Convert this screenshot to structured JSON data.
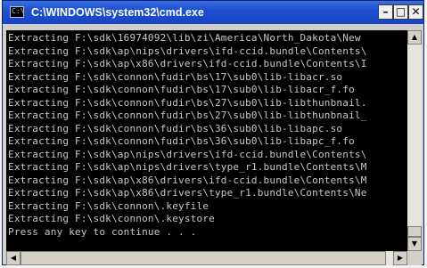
{
  "window": {
    "title": "C:\\WINDOWS\\system32\\cmd.exe",
    "icon_label": "C:\\",
    "buttons": {
      "minimize": "–",
      "maximize": "□",
      "close": "✕"
    }
  },
  "console": {
    "lines": [
      "Extracting F:\\sdk\\16974092\\lib\\zi\\America\\North_Dakota\\New",
      "Extracting F:\\sdk\\ap\\nips\\drivers\\ifd-ccid.bundle\\Contents\\",
      "Extracting F:\\sdk\\ap\\x86\\drivers\\ifd-ccid.bundle\\Contents\\I",
      "Extracting F:\\sdk\\connon\\fudir\\bs\\17\\sub0\\lib-libacr.so",
      "Extracting F:\\sdk\\connon\\fudir\\bs\\17\\sub0\\lib-libacr_f.fo",
      "Extracting F:\\sdk\\connon\\fudir\\bs\\27\\sub0\\lib-libthunbnail.",
      "Extracting F:\\sdk\\connon\\fudir\\bs\\27\\sub0\\lib-libthunbnail_",
      "Extracting F:\\sdk\\connon\\fudir\\bs\\36\\sub0\\lib-libapc.so",
      "Extracting F:\\sdk\\connon\\fudir\\bs\\36\\sub0\\lib-libapc_f.fo",
      "Extracting F:\\sdk\\ap\\nips\\drivers\\ifd-ccid.bundle\\Contents\\",
      "Extracting F:\\sdk\\ap\\nips\\drivers\\type_r1.bundle\\Contents\\M",
      "Extracting F:\\sdk\\ap\\x86\\drivers\\ifd-ccid.bundle\\Contents\\M",
      "Extracting F:\\sdk\\ap\\x86\\drivers\\type_r1.bundle\\Contents\\Ne",
      "Extracting F:\\sdk\\connon\\.keyfile",
      "Extracting F:\\sdk\\connon\\.keystore",
      "Press any key to continue . . ."
    ]
  },
  "scrollbars": {
    "up_arrow": "▲",
    "down_arrow": "▼",
    "left_arrow": "◀",
    "right_arrow": "▶"
  }
}
